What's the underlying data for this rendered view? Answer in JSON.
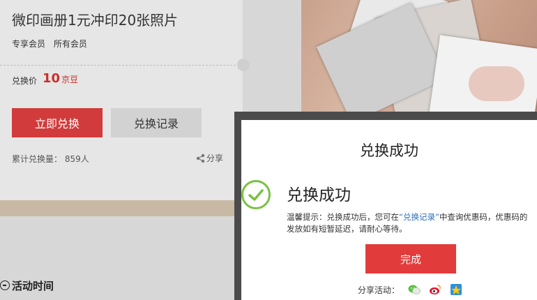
{
  "product": {
    "title": "微印画册1元冲印20张照片",
    "tags": [
      "专享会员",
      "所有会员"
    ],
    "price_label": "兑换价",
    "price_value": "10",
    "price_unit": "京豆",
    "redeem_button": "立即兑换",
    "records_button": "兑换记录",
    "count_text": "累计兑换量： 859人",
    "share_label": "分享"
  },
  "activity_label": "活动时间",
  "modal": {
    "title": "兑换成功",
    "success_text": "兑换成功",
    "notice_prefix": "温馨提示：兑换成功后，您可在",
    "notice_link": "“兑换记录”",
    "notice_suffix": "中查询优惠码，优惠码的发放如有短暂延迟，请耐心等待。",
    "done_button": "完成",
    "share_label": "分享活动："
  },
  "colors": {
    "primary_red": "#d13b3b",
    "done_red": "#e23b3b",
    "price_red": "#c9302c",
    "success_green": "#7ac143",
    "link_blue": "#2a6eb8"
  },
  "icons": {
    "share": "share-icon",
    "check": "check-circle-icon",
    "clock": "clock-icon",
    "wechat": "wechat-icon",
    "weibo": "weibo-icon",
    "qzone": "qzone-icon"
  }
}
